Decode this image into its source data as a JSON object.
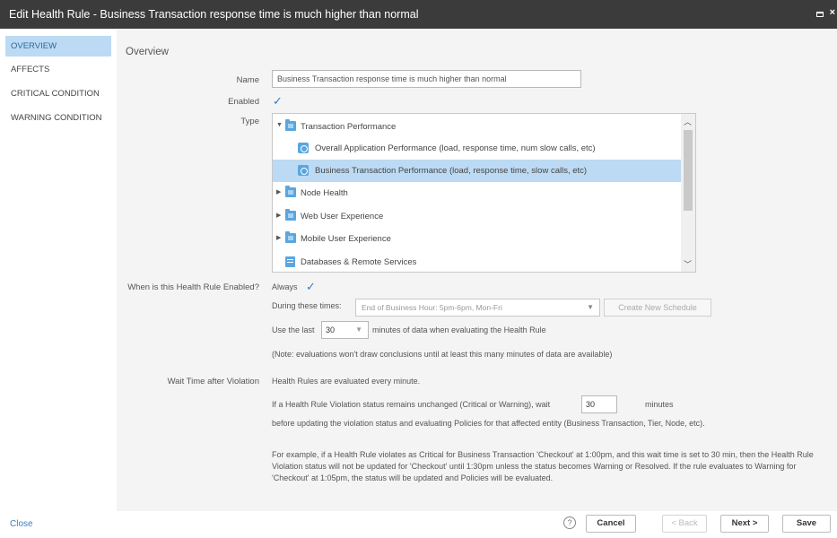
{
  "window": {
    "title": "Edit Health Rule - Business Transaction response time is much higher than normal"
  },
  "sidebar": {
    "items": [
      {
        "label": "OVERVIEW"
      },
      {
        "label": "AFFECTS"
      },
      {
        "label": "CRITICAL CONDITION"
      },
      {
        "label": "WARNING CONDITION"
      }
    ],
    "close_label": "Close"
  },
  "overview": {
    "section_title": "Overview",
    "name_label": "Name",
    "name_value": "Business Transaction response time is much higher than normal",
    "enabled_label": "Enabled",
    "type_label": "Type",
    "type_tree": [
      {
        "label": "Transaction Performance"
      },
      {
        "label": "Overall Application Performance (load, response time, num slow calls, etc)"
      },
      {
        "label": "Business Transaction Performance (load, response time, slow calls, etc)"
      },
      {
        "label": "Node Health"
      },
      {
        "label": "Web User Experience"
      },
      {
        "label": "Mobile User Experience"
      },
      {
        "label": "Databases & Remote Services"
      }
    ],
    "when_enabled_label": "When is this Health Rule Enabled?",
    "always_label": "Always",
    "during_label": "During these times:",
    "schedule_value": "End of Business Hour: 5pm-6pm, Mon-Fri",
    "create_schedule_label": "Create New Schedule",
    "use_last_label": "Use the last",
    "minutes_value": "30",
    "minutes_suffix": "minutes of data when evaluating the Health Rule",
    "note": "(Note: evaluations won't draw conclusions until at least this many minutes of data are available)",
    "wait_label": "Wait Time after Violation",
    "evaluated_text": "Health Rules are evaluated every minute.",
    "unchanged_text": "If a Health Rule Violation status remains unchanged (Critical or Warning), wait",
    "wait_value": "30",
    "wait_suffix": "minutes",
    "before_text": "before updating the violation status and evaluating Policies for that affected entity (Business Transaction, Tier, Node, etc).",
    "example_text": "For example, if a Health Rule violates as Critical for Business Transaction 'Checkout' at 1:00pm, and this wait time is set to 30 min, then the Health Rule Violation status will not be updated for 'Checkout' until 1:30pm unless the status becomes Warning or Resolved. If the rule evaluates to Warning for 'Checkout' at 1:05pm, the status will be updated and Policies will be evaluated."
  },
  "footer": {
    "help": "?",
    "cancel": "Cancel",
    "back": "< Back",
    "next": "Next >",
    "save": "Save"
  }
}
